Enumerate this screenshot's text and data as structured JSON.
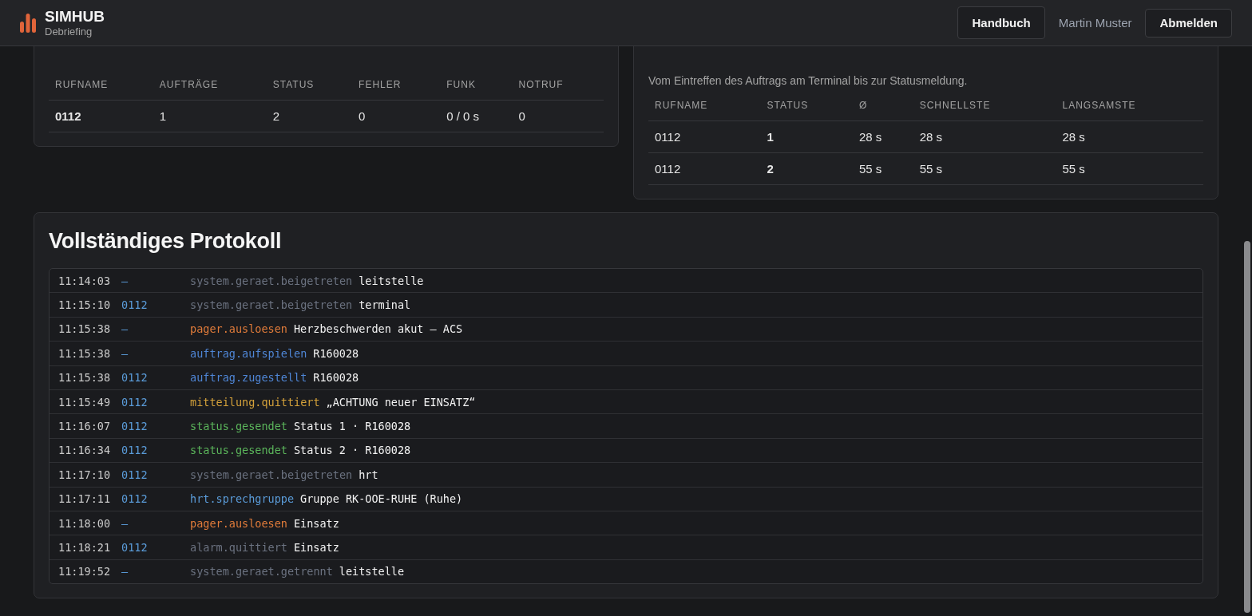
{
  "header": {
    "brand": "SIMHUB",
    "subtitle": "Debriefing",
    "manual_button": "Handbuch",
    "user": "Martin Muster",
    "logout_button": "Abmelden"
  },
  "unit_stats": {
    "columns": [
      "RUFNAME",
      "AUFTRÄGE",
      "STATUS",
      "FEHLER",
      "FUNK",
      "NOTRUF"
    ],
    "rows": [
      [
        "0112",
        "1",
        "2",
        "0",
        "0 / 0 s",
        "0"
      ]
    ]
  },
  "reaction_times": {
    "description": "Vom Eintreffen des Auftrags am Terminal bis zur Statusmeldung.",
    "columns": [
      "RUFNAME",
      "STATUS",
      "Ø",
      "SCHNELLSTE",
      "LANGSAMSTE"
    ],
    "rows": [
      [
        "0112",
        "1",
        "28 s",
        "28 s",
        "28 s"
      ],
      [
        "0112",
        "2",
        "55 s",
        "55 s",
        "55 s"
      ]
    ]
  },
  "protocol": {
    "title": "Vollständiges Protokoll",
    "entries": [
      {
        "time": "11:14:03",
        "unit": "—",
        "event": "system.geraet.beigetreten",
        "color": "#6b7280",
        "detail": "leitstelle"
      },
      {
        "time": "11:15:10",
        "unit": "0112",
        "event": "system.geraet.beigetreten",
        "color": "#6b7280",
        "detail": "terminal"
      },
      {
        "time": "11:15:38",
        "unit": "—",
        "event": "pager.ausloesen",
        "color": "#e07b3a",
        "detail": "Herzbeschwerden akut – ACS"
      },
      {
        "time": "11:15:38",
        "unit": "—",
        "event": "auftrag.aufspielen",
        "color": "#4f86d6",
        "detail": "R160028"
      },
      {
        "time": "11:15:38",
        "unit": "0112",
        "event": "auftrag.zugestellt",
        "color": "#4f86d6",
        "detail": "R160028"
      },
      {
        "time": "11:15:49",
        "unit": "0112",
        "event": "mitteilung.quittiert",
        "color": "#d4a13a",
        "detail": "„ACHTUNG neuer EINSATZ“"
      },
      {
        "time": "11:16:07",
        "unit": "0112",
        "event": "status.gesendet",
        "color": "#5bb55b",
        "detail": "Status 1 · R160028"
      },
      {
        "time": "11:16:34",
        "unit": "0112",
        "event": "status.gesendet",
        "color": "#5bb55b",
        "detail": "Status 2 · R160028"
      },
      {
        "time": "11:17:10",
        "unit": "0112",
        "event": "system.geraet.beigetreten",
        "color": "#6b7280",
        "detail": "hrt"
      },
      {
        "time": "11:17:11",
        "unit": "0112",
        "event": "hrt.sprechgruppe",
        "color": "#5a9bd8",
        "detail": "Gruppe RK-OOE-RUHE (Ruhe)"
      },
      {
        "time": "11:18:00",
        "unit": "—",
        "event": "pager.ausloesen",
        "color": "#e07b3a",
        "detail": "Einsatz"
      },
      {
        "time": "11:18:21",
        "unit": "0112",
        "event": "alarm.quittiert",
        "color": "#6b7280",
        "detail": "Einsatz"
      },
      {
        "time": "11:19:52",
        "unit": "—",
        "event": "system.geraet.getrennt",
        "color": "#6b7280",
        "detail": "leitstelle"
      }
    ]
  }
}
